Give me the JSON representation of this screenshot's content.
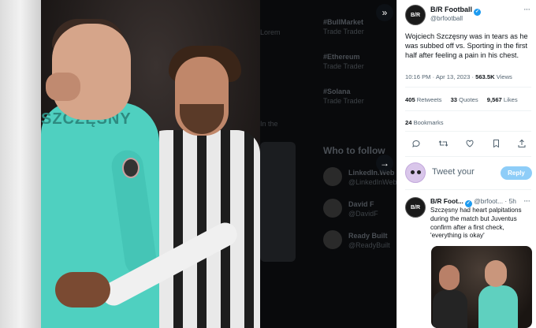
{
  "background_feed": {
    "trends": [
      {
        "tag": "#BullMarket",
        "sub": "Trade Trader"
      },
      {
        "tag": "#Ethereum",
        "sub": "Trade Trader"
      },
      {
        "tag": "#Solana",
        "sub": "Trade Trader"
      }
    ],
    "side_texts": [
      "Lorem",
      "In the"
    ],
    "who_to_follow": "Who to follow",
    "follows": [
      {
        "name": "LinkedIn.Web",
        "handle": "@LinkedInWeb"
      },
      {
        "name": "David F",
        "handle": "@DavidF"
      },
      {
        "name": "Ready Built",
        "handle": "@ReadyBuilt"
      }
    ]
  },
  "photo": {
    "jersey_text": "SZCZĘSNY",
    "expand_icon": "»",
    "next_icon": "→"
  },
  "tweet": {
    "author": {
      "avatar_text": "B/R",
      "name": "B/R Football",
      "handle": "@brfootball"
    },
    "more_icon": "···",
    "text": "Wojciech Szczęsny was in tears as he was subbed off vs. Sporting in the first half after feeling a pain in his chest.",
    "time": "10:16 PM",
    "date": "Apr 13, 2023",
    "views_count": "563.5K",
    "views_label": "Views",
    "retweets_count": "405",
    "retweets_label": "Retweets",
    "quotes_count": "33",
    "quotes_label": "Quotes",
    "likes_count": "9,567",
    "likes_label": "Likes",
    "bookmarks_count": "24",
    "bookmarks_label": "Bookmarks",
    "actions": {
      "reply": "💬",
      "retweet": "⇄",
      "like": "♡",
      "bookmark": "🔖",
      "share": "⇪"
    },
    "reply_placeholder": "Tweet your",
    "reply_button": "Reply"
  },
  "reply_tweet": {
    "avatar_text": "B/R",
    "name": "B/R Foot...",
    "handle": "@brfoot...",
    "time": "5h",
    "more_icon": "···",
    "text": "Szczęsny had heart palpitations during the match but Juventus confirm after a first check, 'everything is okay'"
  },
  "colors": {
    "accent": "#1d9bf0",
    "reply_button_bg": "#8ecdf8",
    "text_secondary": "#536471"
  }
}
